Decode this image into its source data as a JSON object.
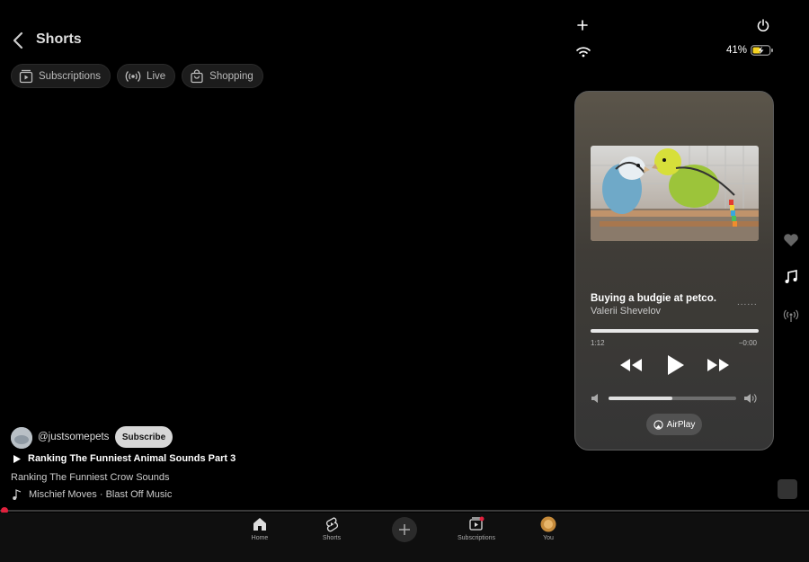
{
  "header": {
    "title": "Shorts"
  },
  "chips": [
    {
      "label": "Subscriptions",
      "icon": "subscriptions-icon"
    },
    {
      "label": "Live",
      "icon": "live-icon"
    },
    {
      "label": "Shopping",
      "icon": "shopping-bag-icon"
    }
  ],
  "status_bar": {
    "battery": "41%"
  },
  "now_playing": {
    "title": "Buying a budgie at petco.",
    "artist": "Valerii Shevelov",
    "more": "......",
    "elapsed": "1:12",
    "remaining": "−0:00",
    "progress": 1.0,
    "volume": 0.5,
    "airplay_label": "AirPlay"
  },
  "video": {
    "channel": "@justsomepets",
    "subscribe_label": "Subscribe",
    "playlist": "Ranking The Funniest Animal Sounds Part 3",
    "title": "Ranking The Funniest Crow Sounds",
    "music": "Mischief Moves · Blast Off Music"
  },
  "nav": [
    {
      "label": "Home",
      "icon": "home-icon"
    },
    {
      "label": "Shorts",
      "icon": "shorts-icon"
    },
    {
      "label": "Subscriptions",
      "icon": "subscriptions-icon"
    },
    {
      "label": "You",
      "icon": "avatar"
    }
  ],
  "colors": {
    "accent": "#e0213d",
    "battery": "#f5d322"
  }
}
